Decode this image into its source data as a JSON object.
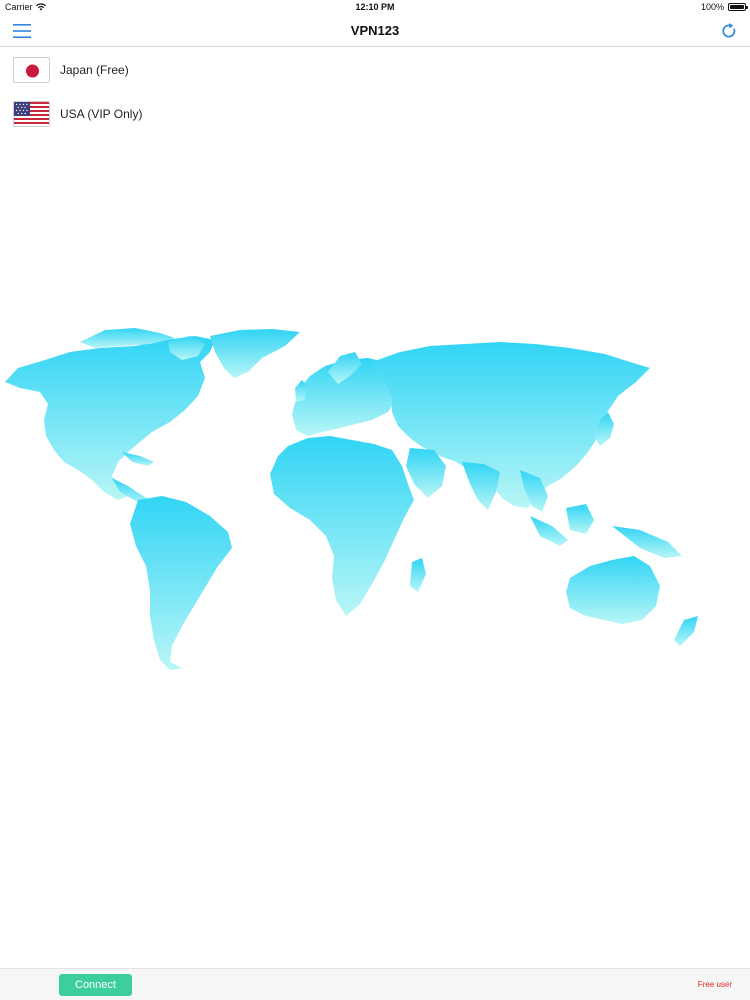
{
  "status_bar": {
    "carrier": "Carrier",
    "time": "12:10 PM",
    "battery": "100%",
    "battery_level": 1.0
  },
  "nav": {
    "title": "VPN123",
    "menu_icon": "hamburger-menu-icon",
    "refresh_icon": "refresh-icon",
    "accent_color": "#2f86e0"
  },
  "servers": [
    {
      "label": "Japan (Free)",
      "flag_icon": "japan-flag-icon"
    },
    {
      "label": "USA (VIP Only)",
      "flag_icon": "usa-flag-icon"
    }
  ],
  "map": {
    "gradient_top": "#31d4f5",
    "gradient_bottom": "#b8f6f6"
  },
  "footer": {
    "connect_label": "Connect",
    "connect_color": "#3ccf9d",
    "user_status": "Free user",
    "user_status_color": "#e0272b"
  }
}
